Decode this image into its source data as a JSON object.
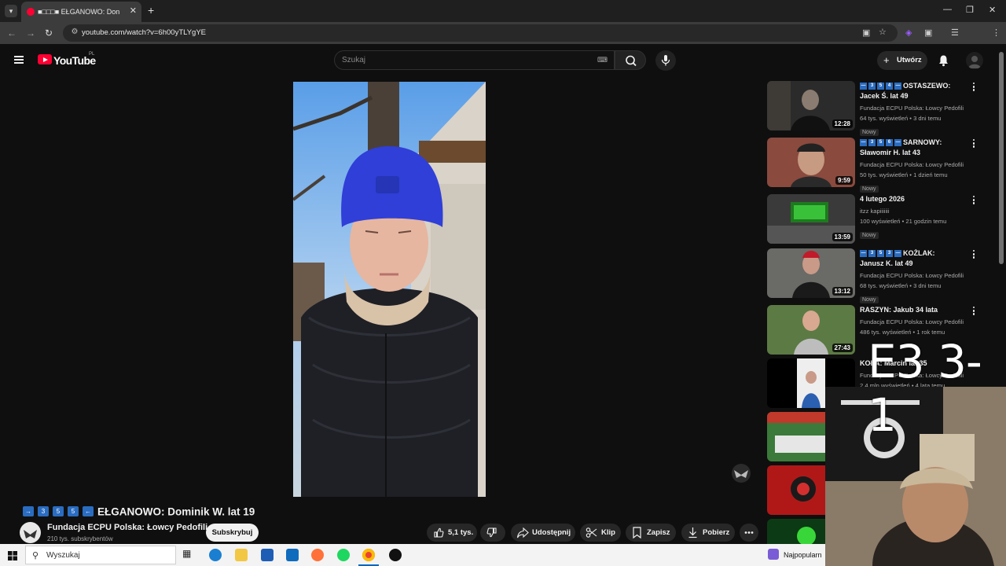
{
  "browser": {
    "tab_title": "➡️3️⃣5️⃣5️⃣⬅️ EŁGANOWO: Domi",
    "tab_title_display": "■□□□■ EŁGANOWO: Don",
    "url": "youtube.com/watch?v=6h00yTLYgYE"
  },
  "youtube": {
    "logo_text": "YouTube",
    "region": "PL",
    "search_placeholder": "Szukaj",
    "create_label": "Utwórz"
  },
  "video": {
    "title_boxes": [
      "→",
      "3",
      "5",
      "5",
      "←"
    ],
    "title": "EŁGANOWO: Dominik W. lat 19",
    "channel_name": "Fundacja ECPU Polska: Łowcy Pedofili",
    "subscribers": "210 tys. subskrybentów",
    "subscribe_label": "Subskrybuj",
    "likes": "5,1 tys.",
    "share_label": "Udostępnij",
    "clip_label": "Klip",
    "save_label": "Zapisz",
    "download_label": "Pobierz"
  },
  "recommendations": [
    {
      "boxes": [
        "—",
        "3",
        "5",
        "4",
        "—"
      ],
      "title": "OSTASZEWO: Jacek Ś. lat 49",
      "channel": "Fundacja ECPU Polska: Łowcy Pedofili",
      "views": "64 tys. wyświetleń • 3 dni temu",
      "badge": "Nowy",
      "duration": "12:28"
    },
    {
      "boxes": [
        "—",
        "3",
        "5",
        "6",
        "—"
      ],
      "title": "SARNOWY: Sławomir H. lat 43",
      "channel": "Fundacja ECPU Polska: Łowcy Pedofili",
      "views": "50 tys. wyświetleń • 1 dzień temu",
      "badge": "Nowy",
      "duration": "9:59"
    },
    {
      "boxes": [],
      "title": "4 lutego 2026",
      "channel": "itzz kapiiiiiii",
      "views": "100 wyświetleń • 21 godzin temu",
      "badge": "Nowy",
      "duration": "13:59"
    },
    {
      "boxes": [
        "—",
        "3",
        "5",
        "3",
        "—"
      ],
      "title": "KOŻLAK: Janusz K. lat 49",
      "channel": "Fundacja ECPU Polska: Łowcy Pedofili",
      "views": "68 tys. wyświetleń • 3 dni temu",
      "badge": "Nowy",
      "duration": "13:12"
    },
    {
      "boxes": [],
      "title": "RASZYN: Jakub 34 lata",
      "channel": "Fundacja ECPU Polska: Łowcy Pedofili",
      "views": "486 tys. wyświetleń • 1 rok temu",
      "badge": "",
      "duration": "27:43"
    },
    {
      "boxes": [],
      "title": "KOŁA: Marcin lat 35",
      "channel": "Fundacja ECPU Polska: Łowcy Pedofili",
      "views": "2,4 mln wyświetleń • 4 lata temu",
      "badge": "",
      "duration": ""
    }
  ],
  "overlay": {
    "score_text": "E3 3-1"
  },
  "taskbar": {
    "search_placeholder": "Wyszukaj",
    "news_text": "Najpopularn"
  }
}
